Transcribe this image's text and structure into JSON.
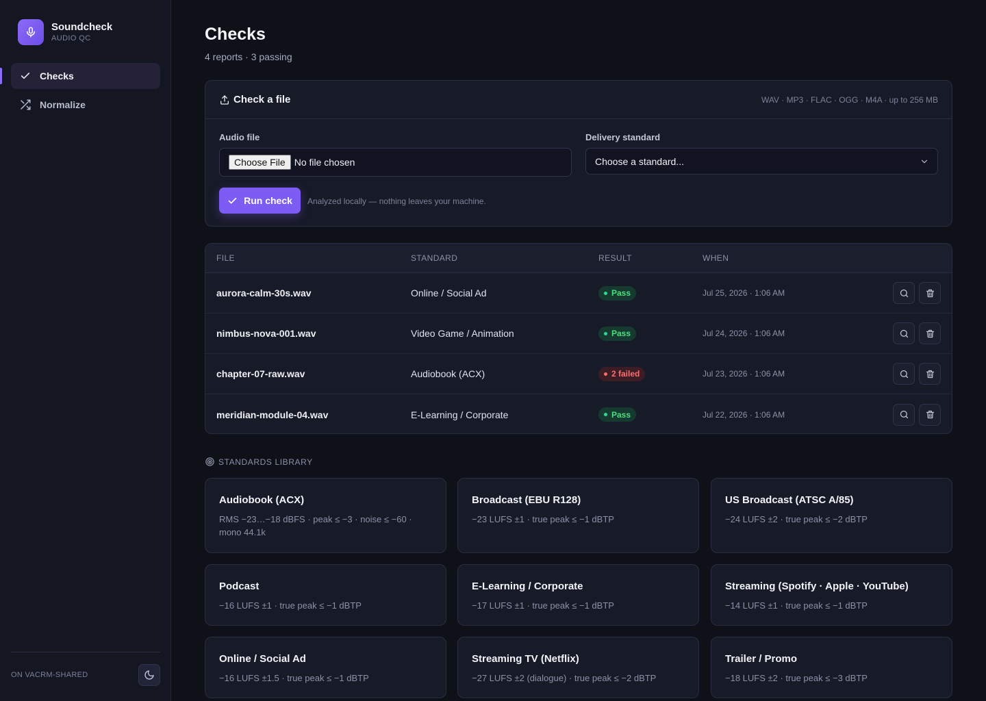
{
  "app": {
    "name": "Soundcheck",
    "subtitle": "AUDIO QC"
  },
  "nav": {
    "items": [
      {
        "label": "Checks",
        "icon": "check-icon",
        "active": true
      },
      {
        "label": "Normalize",
        "icon": "shuffle-icon",
        "active": false
      }
    ]
  },
  "sidebar_footer": {
    "env": "ON VACRM-SHARED",
    "theme_icon": "moon-icon"
  },
  "page": {
    "title": "Checks",
    "subtitle": "4 reports · 3 passing"
  },
  "upload": {
    "title": "Check a file",
    "formats": "WAV · MP3 · FLAC · OGG · M4A · up to 256 MB",
    "audio_label": "Audio file",
    "choose_button": "Choose File",
    "file_value": "No file chosen",
    "standard_label": "Delivery standard",
    "standard_placeholder": "Choose a standard...",
    "run_button": "Run check",
    "note": "Analyzed locally — nothing leaves your machine."
  },
  "table": {
    "headers": {
      "file": "FILE",
      "standard": "STANDARD",
      "result": "RESULT",
      "when": "WHEN"
    },
    "rows": [
      {
        "file": "aurora-calm-30s.wav",
        "standard": "Online / Social Ad",
        "result": "Pass",
        "status": "pass",
        "when": "Jul 25, 2026 · 1:06 AM"
      },
      {
        "file": "nimbus-nova-001.wav",
        "standard": "Video Game / Animation",
        "result": "Pass",
        "status": "pass",
        "when": "Jul 24, 2026 · 1:06 AM"
      },
      {
        "file": "chapter-07-raw.wav",
        "standard": "Audiobook (ACX)",
        "result": "2 failed",
        "status": "fail",
        "when": "Jul 23, 2026 · 1:06 AM"
      },
      {
        "file": "meridian-module-04.wav",
        "standard": "E-Learning / Corporate",
        "result": "Pass",
        "status": "pass",
        "when": "Jul 22, 2026 · 1:06 AM"
      }
    ]
  },
  "library": {
    "heading": "STANDARDS LIBRARY",
    "standards": [
      {
        "name": "Audiobook (ACX)",
        "spec": "RMS −23…−18 dBFS · peak ≤ −3 · noise ≤ −60 · mono 44.1k"
      },
      {
        "name": "Broadcast (EBU R128)",
        "spec": "−23 LUFS ±1 · true peak ≤ −1 dBTP"
      },
      {
        "name": "US Broadcast (ATSC A/85)",
        "spec": "−24 LUFS ±2 · true peak ≤ −2 dBTP"
      },
      {
        "name": "Podcast",
        "spec": "−16 LUFS ±1 · true peak ≤ −1 dBTP"
      },
      {
        "name": "E-Learning / Corporate",
        "spec": "−17 LUFS ±1 · true peak ≤ −1 dBTP"
      },
      {
        "name": "Streaming (Spotify · Apple · YouTube)",
        "spec": "−14 LUFS ±1 · true peak ≤ −1 dBTP"
      },
      {
        "name": "Online / Social Ad",
        "spec": "−16 LUFS ±1.5 · true peak ≤ −1 dBTP"
      },
      {
        "name": "Streaming TV (Netflix)",
        "spec": "−27 LUFS ±2 (dialogue) · true peak ≤ −2 dBTP"
      },
      {
        "name": "Trailer / Promo",
        "spec": "−18 LUFS ±2 · true peak ≤ −3 dBTP"
      }
    ]
  },
  "colors": {
    "accent": "#7c5cf2",
    "pass": "#4ade80",
    "fail": "#f87171",
    "background": "#0f1119"
  }
}
